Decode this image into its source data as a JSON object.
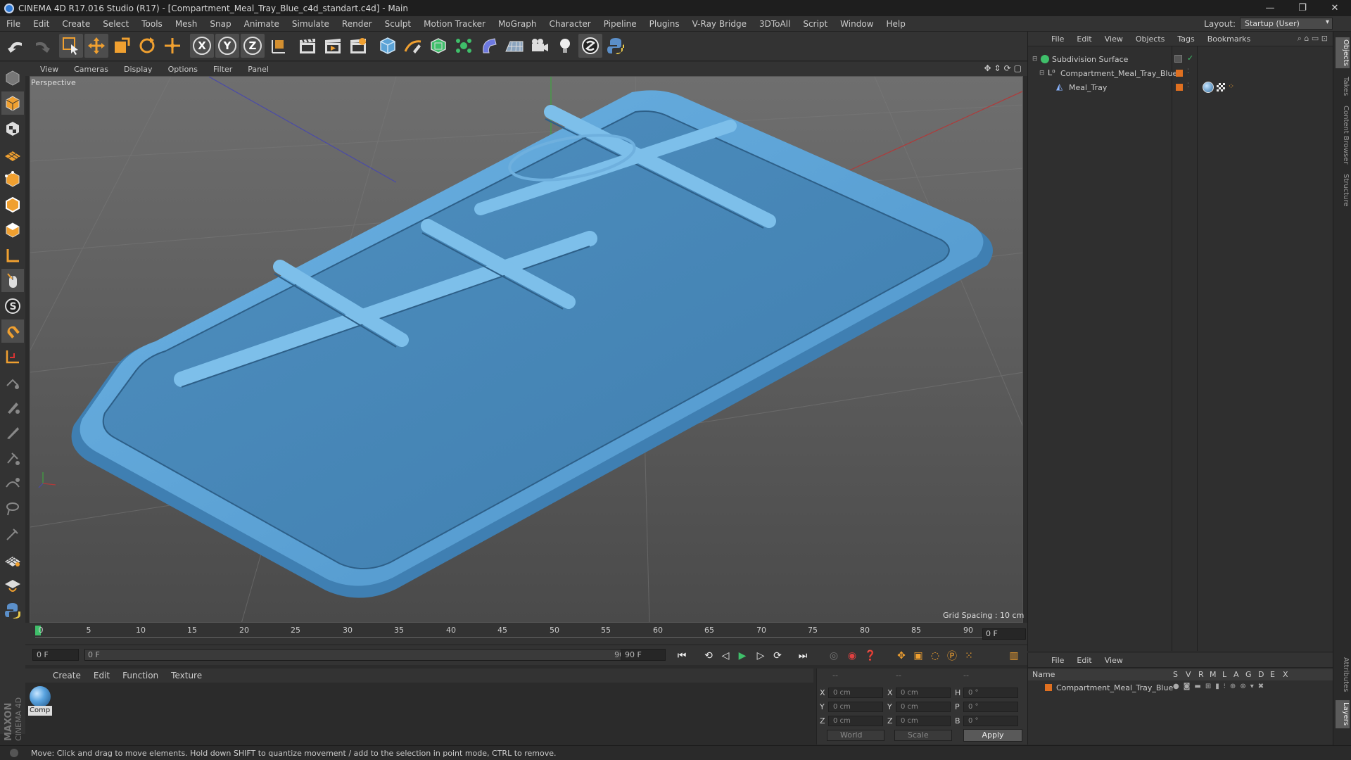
{
  "window": {
    "title": "CINEMA 4D R17.016 Studio (R17) - [Compartment_Meal_Tray_Blue_c4d_standart.c4d] - Main",
    "minimize": "—",
    "maximize": "❐",
    "close": "✕"
  },
  "menu": [
    "File",
    "Edit",
    "Create",
    "Select",
    "Tools",
    "Mesh",
    "Snap",
    "Animate",
    "Simulate",
    "Render",
    "Sculpt",
    "Motion Tracker",
    "MoGraph",
    "Character",
    "Pipeline",
    "Plugins",
    "V-Ray Bridge",
    "3DToAll",
    "Script",
    "Window",
    "Help"
  ],
  "layout": {
    "label": "Layout:",
    "value": "Startup (User)"
  },
  "toolbar": {
    "axis_x": "X",
    "axis_y": "Y",
    "axis_z": "Z"
  },
  "viewport": {
    "menu": [
      "View",
      "Cameras",
      "Display",
      "Options",
      "Filter",
      "Panel"
    ],
    "label": "Perspective",
    "grid_spacing": "Grid Spacing : 10 cm"
  },
  "timeline": {
    "ticks": [
      "0",
      "5",
      "10",
      "15",
      "20",
      "25",
      "30",
      "35",
      "40",
      "45",
      "50",
      "55",
      "60",
      "65",
      "70",
      "75",
      "80",
      "85",
      "90"
    ],
    "current_frame": "0 F"
  },
  "transport": {
    "start_frame": "0 F",
    "range_start": "0 F",
    "range_end": "90 F",
    "end_frame": "90 F"
  },
  "material_manager": {
    "menu": [
      "Create",
      "Edit",
      "Function",
      "Texture"
    ],
    "material_name": "Comp"
  },
  "coordinates": {
    "header": [
      "--",
      "--",
      "--"
    ],
    "rows": [
      {
        "a": "X",
        "av": "0 cm",
        "b": "X",
        "bv": "0 cm",
        "c": "H",
        "cv": "0 °"
      },
      {
        "a": "Y",
        "av": "0 cm",
        "b": "Y",
        "bv": "0 cm",
        "c": "P",
        "cv": "0 °"
      },
      {
        "a": "Z",
        "av": "0 cm",
        "b": "Z",
        "bv": "0 cm",
        "c": "B",
        "cv": "0 °"
      }
    ],
    "space": "World",
    "mode": "Scale",
    "apply": "Apply"
  },
  "object_manager": {
    "menu": [
      "File",
      "Edit",
      "View",
      "Objects",
      "Tags",
      "Bookmarks"
    ],
    "objects": [
      {
        "name": "Subdivision Surface"
      },
      {
        "name": "Compartment_Meal_Tray_Blue"
      },
      {
        "name": "Meal_Tray"
      }
    ]
  },
  "layer_manager": {
    "menu": [
      "File",
      "Edit",
      "View"
    ],
    "columns": [
      "Name",
      "S",
      "V",
      "R",
      "M",
      "L",
      "A",
      "G",
      "D",
      "E",
      "X"
    ],
    "layers": [
      {
        "name": "Compartment_Meal_Tray_Blue"
      }
    ]
  },
  "side_tabs": [
    "Objects",
    "Takes",
    "Content Browser",
    "Structure",
    "Attributes",
    "Layers"
  ],
  "branding": "MAXON CINEMA 4D",
  "status": "Move: Click and drag to move elements. Hold down SHIFT to quantize movement / add to the selection in point mode, CTRL to remove.",
  "colors": {
    "tray": "#5ba3d6",
    "accent_orange": "#f0a030",
    "layer_orange": "#e07020",
    "bg": "#2b2b2b"
  }
}
